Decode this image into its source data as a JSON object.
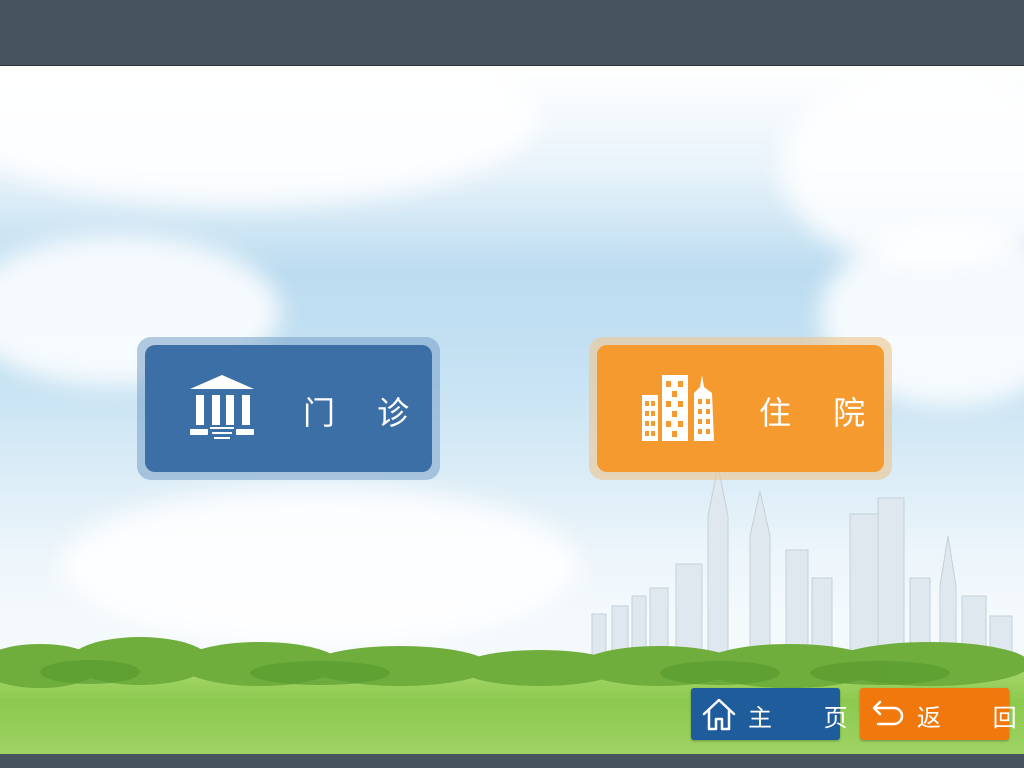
{
  "menu": {
    "outpatient": {
      "label": "门 诊",
      "icon": "bank-building-icon",
      "color": "#3b6fa5"
    },
    "inpatient": {
      "label": "住 院",
      "icon": "hospital-buildings-icon",
      "color": "#f59a2f"
    }
  },
  "nav": {
    "home": {
      "label": "主 页",
      "icon": "home-icon",
      "color": "#1f5c9c"
    },
    "back": {
      "label": "返 回",
      "icon": "back-arrow-icon",
      "color": "#f0780c"
    }
  }
}
